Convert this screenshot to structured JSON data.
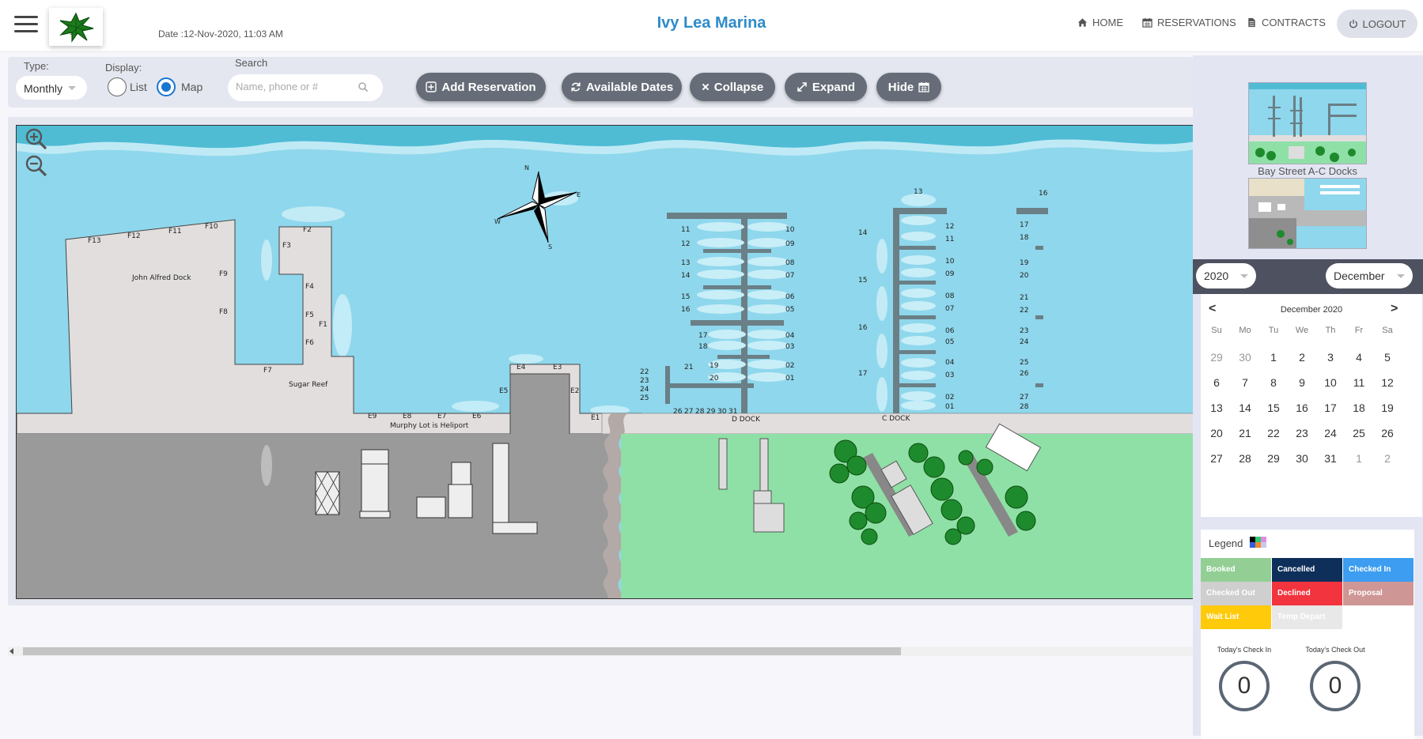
{
  "header": {
    "date_text": "Date :12-Nov-2020, 11:03 AM",
    "title": "Ivy Lea Marina",
    "nav": [
      {
        "label": "HOME",
        "icon": "home-icon"
      },
      {
        "label": "RESERVATIONS",
        "icon": "calendar-icon"
      },
      {
        "label": "CONTRACTS",
        "icon": "document-icon"
      }
    ],
    "logout_label": "LOGOUT"
  },
  "toolbar": {
    "type_label": "Type:",
    "type_value": "Monthly",
    "display_label": "Display:",
    "display_options": [
      {
        "label": "List",
        "selected": false
      },
      {
        "label": "Map",
        "selected": true
      }
    ],
    "search_label": "Search",
    "search_placeholder": "Name, phone or #",
    "buttons": [
      {
        "label": "Add Reservation",
        "icon": "plus-square-icon"
      },
      {
        "label": "Available Dates",
        "icon": "refresh-icon"
      },
      {
        "label": "Collapse",
        "icon": "times-icon"
      },
      {
        "label": "Expand",
        "icon": "expand-icon"
      },
      {
        "label": "Hide",
        "icon": "calendar-icon"
      }
    ]
  },
  "map": {
    "f_dock_slips": [
      "F13",
      "F12",
      "F11",
      "F10",
      "F9",
      "F8",
      "F7",
      "F2",
      "F3",
      "F4",
      "F5",
      "F1",
      "F6"
    ],
    "e_dock_slips": [
      "E9",
      "E8",
      "E7",
      "E6",
      "E5",
      "E4",
      "E3",
      "E2",
      "E1"
    ],
    "place_labels": [
      "John Alfred Dock",
      "Sugar Reef",
      "Murphy Lot is Heliport",
      "D DOCK",
      "C DOCK"
    ],
    "compass": [
      "N",
      "E",
      "S",
      "W"
    ],
    "d_dock_left": [
      "11",
      "12",
      "13",
      "14",
      "15",
      "16",
      "17",
      "18",
      "19",
      "20",
      "21",
      "22",
      "23",
      "24",
      "25"
    ],
    "d_dock_bottom": [
      "26",
      "27",
      "28",
      "29",
      "30",
      "31"
    ],
    "d_dock_right": [
      "10",
      "09",
      "08",
      "07",
      "06",
      "05",
      "04",
      "03",
      "02",
      "01"
    ],
    "c_dock_left": [
      "14",
      "15",
      "16",
      "17"
    ],
    "c_dock_top": "13",
    "c_dock_right": [
      "12",
      "11",
      "10",
      "09",
      "08",
      "07",
      "06",
      "05",
      "04",
      "03",
      "02",
      "01"
    ],
    "b_dock_partial": [
      "17",
      "18",
      "19",
      "20",
      "21",
      "22",
      "23",
      "24",
      "25",
      "26",
      "27",
      "28"
    ],
    "b_dock_top_partial": "16"
  },
  "sidebar": {
    "thumbnails": [
      {
        "caption": "Bay Street A-C Docks"
      }
    ]
  },
  "calendar": {
    "year": "2020",
    "month": "December",
    "title": "December 2020",
    "prev": "<",
    "next": ">",
    "weekdays": [
      "Su",
      "Mo",
      "Tu",
      "We",
      "Th",
      "Fr",
      "Sa"
    ],
    "weeks": [
      [
        "29",
        "30",
        "1",
        "2",
        "3",
        "4",
        "5"
      ],
      [
        "6",
        "7",
        "8",
        "9",
        "10",
        "11",
        "12"
      ],
      [
        "13",
        "14",
        "15",
        "16",
        "17",
        "18",
        "19"
      ],
      [
        "20",
        "21",
        "22",
        "23",
        "24",
        "25",
        "26"
      ],
      [
        "27",
        "28",
        "29",
        "30",
        "31",
        "1",
        "2"
      ]
    ]
  },
  "legend": {
    "title": "Legend",
    "items": [
      {
        "label": "Booked",
        "color": "#93cf95"
      },
      {
        "label": "Cancelled",
        "color": "#0e2f5a"
      },
      {
        "label": "Checked In",
        "color": "#3d9df0"
      },
      {
        "label": "Checked Out",
        "color": "#cfcfcf"
      },
      {
        "label": "Declined",
        "color": "#f1343d"
      },
      {
        "label": "Proposal",
        "color": "#cf9696"
      },
      {
        "label": "Wait List",
        "color": "#ffca0a"
      },
      {
        "label": "Temp Depart",
        "color": "#e8e8e8"
      }
    ],
    "checkin_label": "Today's Check In",
    "checkin_count": "0",
    "checkout_label": "Today's Check Out",
    "checkout_count": "0"
  },
  "colors": {
    "title": "#2e8bc9",
    "toolbar_button": "#666d78",
    "water": "#8fd7ec",
    "land": "#e2dede",
    "grass": "#8fe0a7",
    "parking": "#9a9a9a"
  }
}
